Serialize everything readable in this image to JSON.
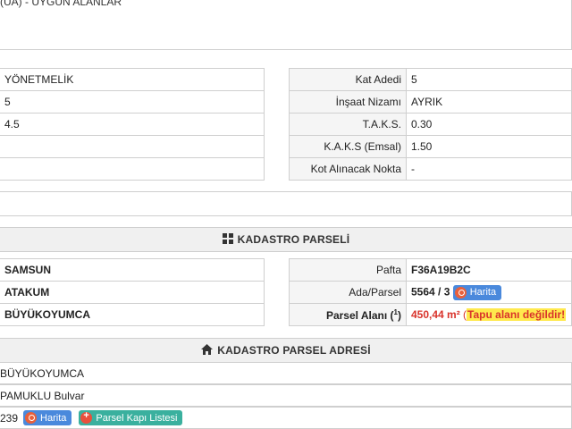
{
  "top": {
    "line1": "(UA) - UYGUN ALANLAR"
  },
  "plan_left": [
    {
      "value": "YÖNETMELİK"
    },
    {
      "value": "5"
    },
    {
      "value": "4.5"
    },
    {
      "value": ""
    },
    {
      "value": ""
    }
  ],
  "plan_right": [
    {
      "label": "Kat Adedi",
      "value": "5"
    },
    {
      "label": "İnşaat Nizamı",
      "value": "AYRIK"
    },
    {
      "label": "T.A.K.S.",
      "value": "0.30"
    },
    {
      "label": "K.A.K.S (Emsal)",
      "value": "1.50"
    },
    {
      "label": "Kot Alınacak Nokta",
      "value": "-"
    }
  ],
  "kadastro": {
    "title": "KADASTRO PARSELİ",
    "left": [
      "SAMSUN",
      "ATAKUM",
      "BÜYÜKOYUMCA"
    ],
    "pafta_label": "Pafta",
    "pafta_value": "F36A19B2C",
    "ada_label": "Ada/Parsel",
    "ada_value": "5564 / 3",
    "harita_label": "Harita",
    "alan_label": "Parsel Alanı (",
    "alan_sup": "1",
    "alan_close": ")",
    "alan_value": "450,44 m²",
    "alan_paren_open": "(",
    "alan_note": "Tapu alanı değildir!"
  },
  "adres": {
    "title": "KADASTRO PARSEL ADRESİ",
    "mahalle": "BÜYÜKOYUMCA",
    "sokak": "PAMUKLU Bulvar",
    "kapi": "239",
    "harita_label": "Harita",
    "kapi_listesi_label": "Parsel Kapı Listesi"
  },
  "colors": {
    "accent_blue": "#4a89dc",
    "accent_green": "#3ab09e",
    "warning_red": "#d9332b",
    "highlight_yellow": "#ffe94d"
  }
}
